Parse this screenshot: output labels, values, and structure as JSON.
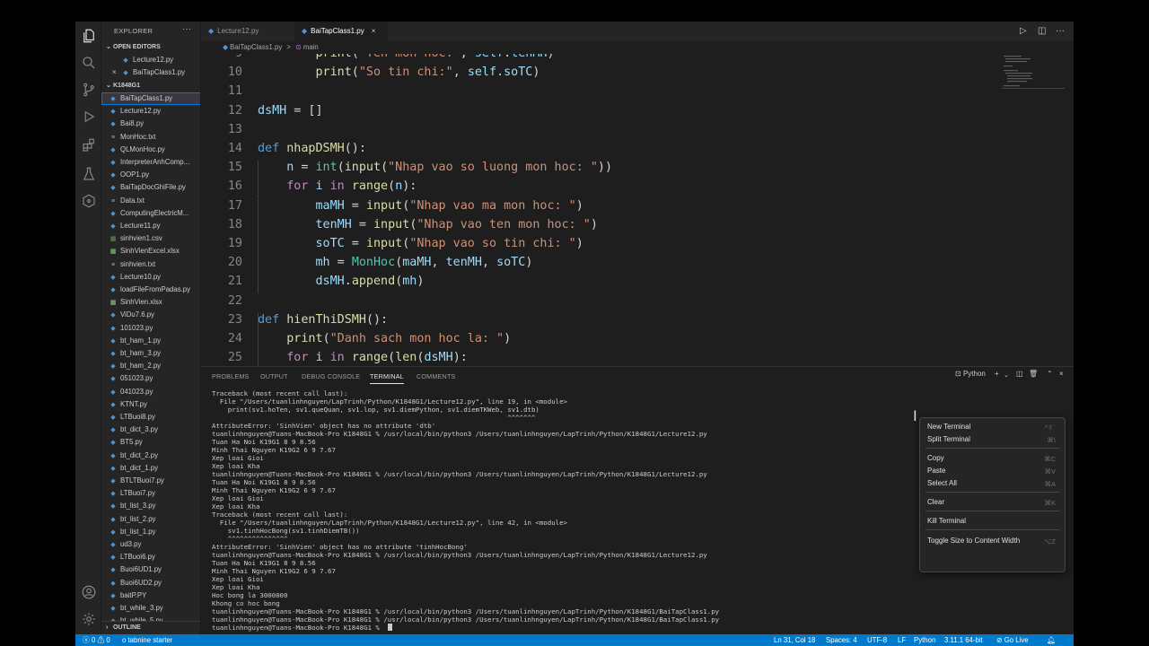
{
  "explorer": {
    "title": "EXPLORER",
    "more": "···",
    "open_editors_label": "OPEN EDITORS",
    "open_editors": [
      {
        "name": "Lecture12.py",
        "close": ""
      },
      {
        "name": "BaiTapClass1.py",
        "close": "×"
      }
    ],
    "folder_label": "K1848G1",
    "files": [
      {
        "name": "BaiTapClass1.py",
        "icon": "py"
      },
      {
        "name": "Lecture12.py",
        "icon": "py"
      },
      {
        "name": "Bai8.py",
        "icon": "py"
      },
      {
        "name": "MonHoc.txt",
        "icon": "txt"
      },
      {
        "name": "QLMonHoc.py",
        "icon": "py"
      },
      {
        "name": "InterpreterAnhComp...",
        "icon": "py"
      },
      {
        "name": "OOP1.py",
        "icon": "py"
      },
      {
        "name": "BaiTapDocGhiFile.py",
        "icon": "py"
      },
      {
        "name": "Data.txt",
        "icon": "txt"
      },
      {
        "name": "ComputingElectricM...",
        "icon": "py"
      },
      {
        "name": "Lecture11.py",
        "icon": "py"
      },
      {
        "name": "sinhvien1.csv",
        "icon": "csv"
      },
      {
        "name": "SinhVienExcel.xlsx",
        "icon": "xlsx"
      },
      {
        "name": "sinhvien.txt",
        "icon": "txt"
      },
      {
        "name": "Lecture10.py",
        "icon": "py"
      },
      {
        "name": "loadFileFromPadas.py",
        "icon": "py"
      },
      {
        "name": "SinhVien.xlsx",
        "icon": "xlsx"
      },
      {
        "name": "ViDu7.6.py",
        "icon": "py"
      },
      {
        "name": "101023.py",
        "icon": "py"
      },
      {
        "name": "bt_ham_1.py",
        "icon": "py"
      },
      {
        "name": "bt_ham_3.py",
        "icon": "py"
      },
      {
        "name": "bt_ham_2.py",
        "icon": "py"
      },
      {
        "name": "051023.py",
        "icon": "py"
      },
      {
        "name": "041023.py",
        "icon": "py"
      },
      {
        "name": "KTNT.py",
        "icon": "py"
      },
      {
        "name": "LTBuoi8.py",
        "icon": "py"
      },
      {
        "name": "bt_dict_3.py",
        "icon": "py"
      },
      {
        "name": "BT5.py",
        "icon": "py"
      },
      {
        "name": "bt_dict_2.py",
        "icon": "py"
      },
      {
        "name": "bt_dict_1.py",
        "icon": "py"
      },
      {
        "name": "BTLTBuoi7.py",
        "icon": "py"
      },
      {
        "name": "LTBuoi7.py",
        "icon": "py"
      },
      {
        "name": "bt_list_3.py",
        "icon": "py"
      },
      {
        "name": "bt_list_2.py",
        "icon": "py"
      },
      {
        "name": "bt_list_1.py",
        "icon": "py"
      },
      {
        "name": "ud3.py",
        "icon": "py"
      },
      {
        "name": "LTBuoi6.py",
        "icon": "py"
      },
      {
        "name": "Buoi6UD1.py",
        "icon": "py"
      },
      {
        "name": "Buoi6UD2.py",
        "icon": "py"
      },
      {
        "name": "baitP.PY",
        "icon": "py"
      },
      {
        "name": "bt_while_3.py",
        "icon": "py"
      },
      {
        "name": "bt_while_5.py",
        "icon": "py"
      }
    ],
    "outline_label": "OUTLINE"
  },
  "tabs": [
    {
      "label": "Lecture12.py",
      "active": false
    },
    {
      "label": "BaiTapClass1.py",
      "active": true
    }
  ],
  "breadcrumb": {
    "file": "BaiTapClass1.py",
    "sep": ">",
    "symbol": "main"
  },
  "code_lines": [
    {
      "n": "9",
      "segs": [
        [
          "        ",
          ""
        ],
        [
          "print",
          "fn"
        ],
        [
          "(",
          ""
        ],
        [
          "\"Ten mon hoc:\"",
          "st"
        ],
        [
          ", ",
          ""
        ],
        [
          "self",
          "vr"
        ],
        [
          ".",
          ""
        ],
        [
          "tenMH",
          "vr"
        ],
        [
          ")",
          ""
        ]
      ]
    },
    {
      "n": "10",
      "segs": [
        [
          "        ",
          ""
        ],
        [
          "print",
          "fn"
        ],
        [
          "(",
          ""
        ],
        [
          "\"So tin chi:\"",
          "st"
        ],
        [
          ", ",
          ""
        ],
        [
          "self",
          "vr"
        ],
        [
          ".",
          ""
        ],
        [
          "soTC",
          "vr"
        ],
        [
          ")",
          ""
        ]
      ]
    },
    {
      "n": "11",
      "segs": []
    },
    {
      "n": "12",
      "segs": [
        [
          "dsMH",
          "vr"
        ],
        [
          " = []",
          ""
        ]
      ]
    },
    {
      "n": "13",
      "segs": []
    },
    {
      "n": "14",
      "segs": [
        [
          "def",
          "kw"
        ],
        [
          " ",
          ""
        ],
        [
          "nhapDSMH",
          "fn"
        ],
        [
          "():",
          ""
        ]
      ]
    },
    {
      "n": "15",
      "segs": [
        [
          "    ",
          ""
        ],
        [
          "n",
          "vr"
        ],
        [
          " = ",
          ""
        ],
        [
          "int",
          "bi"
        ],
        [
          "(",
          ""
        ],
        [
          "input",
          "fn"
        ],
        [
          "(",
          ""
        ],
        [
          "\"Nhap vao so luong mon hoc: \"",
          "st"
        ],
        [
          "))",
          ""
        ]
      ]
    },
    {
      "n": "16",
      "segs": [
        [
          "    ",
          ""
        ],
        [
          "for",
          "ctl"
        ],
        [
          " ",
          ""
        ],
        [
          "i",
          "vr"
        ],
        [
          " ",
          ""
        ],
        [
          "in",
          "ctl"
        ],
        [
          " ",
          ""
        ],
        [
          "range",
          "fn"
        ],
        [
          "(",
          ""
        ],
        [
          "n",
          "vr"
        ],
        [
          "):",
          ""
        ]
      ]
    },
    {
      "n": "17",
      "segs": [
        [
          "        ",
          ""
        ],
        [
          "maMH",
          "vr"
        ],
        [
          " = ",
          ""
        ],
        [
          "input",
          "fn"
        ],
        [
          "(",
          ""
        ],
        [
          "\"Nhap vao ma mon hoc: \"",
          "st"
        ],
        [
          ")",
          ""
        ]
      ]
    },
    {
      "n": "18",
      "segs": [
        [
          "        ",
          ""
        ],
        [
          "tenMH",
          "vr"
        ],
        [
          " = ",
          ""
        ],
        [
          "input",
          "fn"
        ],
        [
          "(",
          ""
        ],
        [
          "\"Nhap vao ten mon hoc: \"",
          "st"
        ],
        [
          ")",
          ""
        ]
      ]
    },
    {
      "n": "19",
      "segs": [
        [
          "        ",
          ""
        ],
        [
          "soTC",
          "vr"
        ],
        [
          " = ",
          ""
        ],
        [
          "input",
          "fn"
        ],
        [
          "(",
          ""
        ],
        [
          "\"Nhap vao so tin chi: \"",
          "st"
        ],
        [
          ")",
          ""
        ]
      ]
    },
    {
      "n": "20",
      "segs": [
        [
          "        ",
          ""
        ],
        [
          "mh",
          "vr"
        ],
        [
          " = ",
          ""
        ],
        [
          "MonHoc",
          "bi"
        ],
        [
          "(",
          ""
        ],
        [
          "maMH",
          "vr"
        ],
        [
          ", ",
          ""
        ],
        [
          "tenMH",
          "vr"
        ],
        [
          ", ",
          ""
        ],
        [
          "soTC",
          "vr"
        ],
        [
          ")",
          ""
        ]
      ]
    },
    {
      "n": "21",
      "segs": [
        [
          "        ",
          ""
        ],
        [
          "dsMH",
          "vr"
        ],
        [
          ".",
          ""
        ],
        [
          "append",
          "fn"
        ],
        [
          "(",
          ""
        ],
        [
          "mh",
          "vr"
        ],
        [
          ")",
          ""
        ]
      ]
    },
    {
      "n": "22",
      "segs": []
    },
    {
      "n": "23",
      "segs": [
        [
          "def",
          "kw"
        ],
        [
          " ",
          ""
        ],
        [
          "hienThiDSMH",
          "fn"
        ],
        [
          "():",
          ""
        ]
      ]
    },
    {
      "n": "24",
      "segs": [
        [
          "    ",
          ""
        ],
        [
          "print",
          "fn"
        ],
        [
          "(",
          ""
        ],
        [
          "\"Danh sach mon hoc la: \"",
          "st"
        ],
        [
          ")",
          ""
        ]
      ]
    },
    {
      "n": "25",
      "segs": [
        [
          "    ",
          ""
        ],
        [
          "for",
          "ctl"
        ],
        [
          " ",
          ""
        ],
        [
          "i",
          "vr"
        ],
        [
          " ",
          ""
        ],
        [
          "in",
          "ctl"
        ],
        [
          " ",
          ""
        ],
        [
          "range",
          "fn"
        ],
        [
          "(",
          ""
        ],
        [
          "len",
          "fn"
        ],
        [
          "(",
          ""
        ],
        [
          "dsMH",
          "vr"
        ],
        [
          "):",
          ""
        ]
      ]
    }
  ],
  "panel_tabs": [
    "PROBLEMS",
    "OUTPUT",
    "DEBUG CONSOLE",
    "TERMINAL",
    "COMMENTS"
  ],
  "panel_active": "TERMINAL",
  "terminal_label": "Python",
  "terminal_lines": [
    "Traceback (most recent call last):",
    "  File \"/Users/tuanlinhnguyen/LapTrinh/Python/K1848G1/Lecture12.py\", line 19, in <module>",
    "    print(sv1.hoTen, sv1.queQuan, sv1.lop, sv1.diemPython, sv1.diemTKWeb, sv1.dtb)",
    "                                                                          ^^^^^^^",
    "AttributeError: 'SinhVien' object has no attribute 'dtb'",
    "tuanlinhnguyen@Tuans-MacBook-Pro K1848G1 % /usr/local/bin/python3 /Users/tuanlinhnguyen/LapTrinh/Python/K1848G1/Lecture12.py",
    "Tuan Ha Noi K19G1 8 9 8.56",
    "Minh Thai Nguyen K19G2 6 9 7.67",
    "Xep loai Gioi",
    "Xep loai Kha",
    "tuanlinhnguyen@Tuans-MacBook-Pro K1848G1 % /usr/local/bin/python3 /Users/tuanlinhnguyen/LapTrinh/Python/K1848G1/Lecture12.py",
    "Tuan Ha Noi K19G1 8 9 8.56",
    "Minh Thai Nguyen K19G2 6 9 7.67",
    "Xep loai Gioi",
    "Xep loai Kha",
    "Traceback (most recent call last):",
    "  File \"/Users/tuanlinhnguyen/LapTrinh/Python/K1848G1/Lecture12.py\", line 42, in <module>",
    "    sv1.tinhHocBong(sv1.tinhDiemTB())",
    "    ^^^^^^^^^^^^^^^",
    "AttributeError: 'SinhVien' object has no attribute 'tinhHocBong'",
    "tuanlinhnguyen@Tuans-MacBook-Pro K1848G1 % /usr/local/bin/python3 /Users/tuanlinhnguyen/LapTrinh/Python/K1848G1/Lecture12.py",
    "Tuan Ha Noi K19G1 8 9 8.56",
    "Minh Thai Nguyen K19G2 6 9 7.67",
    "Xep loai Gioi",
    "Xep loai Kha",
    "Hoc bong la 3000000",
    "Khong co hoc bong",
    "tuanlinhnguyen@Tuans-MacBook-Pro K1848G1 % /usr/local/bin/python3 /Users/tuanlinhnguyen/LapTrinh/Python/K1848G1/BaiTapClass1.py",
    "tuanlinhnguyen@Tuans-MacBook-Pro K1848G1 % /usr/local/bin/python3 /Users/tuanlinhnguyen/LapTrinh/Python/K1848G1/BaiTapClass1.py",
    "tuanlinhnguyen@Tuans-MacBook-Pro K1848G1 % "
  ],
  "context_menu": [
    {
      "label": "New Terminal",
      "key": "^⇧`"
    },
    {
      "label": "Split Terminal",
      "key": "⌘\\"
    },
    {
      "label": "Copy",
      "key": "⌘C"
    },
    {
      "label": "Paste",
      "key": "⌘V"
    },
    {
      "label": "Select All",
      "key": "⌘A"
    },
    {
      "label": "Clear",
      "key": "⌘K"
    },
    {
      "label": "Kill Terminal",
      "key": ""
    },
    {
      "label": "Toggle Size to Content Width",
      "key": "⌥Z"
    }
  ],
  "status": {
    "problems": "ⓧ 0 ⚠ 0",
    "tabnine": "o tabnine starter",
    "position": "Ln 31, Col 18",
    "spaces": "Spaces: 4",
    "encoding": "UTF-8",
    "eol": "LF",
    "language": "Python",
    "interpreter": "3.11.1 64-bit",
    "golive": "⊘ Go Live"
  },
  "colors": {
    "accent": "#007acc",
    "selection": "#37373d"
  }
}
